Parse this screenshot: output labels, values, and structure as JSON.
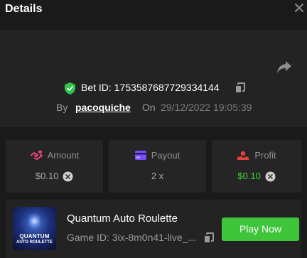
{
  "header": {
    "title": "Details"
  },
  "bet": {
    "label": "Bet ID: 1753587687729334144"
  },
  "byline": {
    "by": "By",
    "user": "pacoquiche",
    "on": "On",
    "date": "29/12/2022 19:05:39"
  },
  "stats": {
    "amount": {
      "label": "Amount",
      "value": "$0.10"
    },
    "payout": {
      "label": "Payout",
      "value": "2 x"
    },
    "profit": {
      "label": "Profit",
      "value": "$0.10"
    }
  },
  "game": {
    "thumb_title": "QUANTUM",
    "thumb_subtitle": "AUTO ROULETTE",
    "name": "Quantum Auto Roulette",
    "id": "Game ID: 3ix-8m0n41-live_...",
    "play_label": "Play Now"
  },
  "colors": {
    "accent_green": "#3fc53a",
    "profit_green": "#3fd43a",
    "amount_pink": "#e8457a",
    "payout_purple": "#7b4dff",
    "profit_red": "#e8413b"
  }
}
